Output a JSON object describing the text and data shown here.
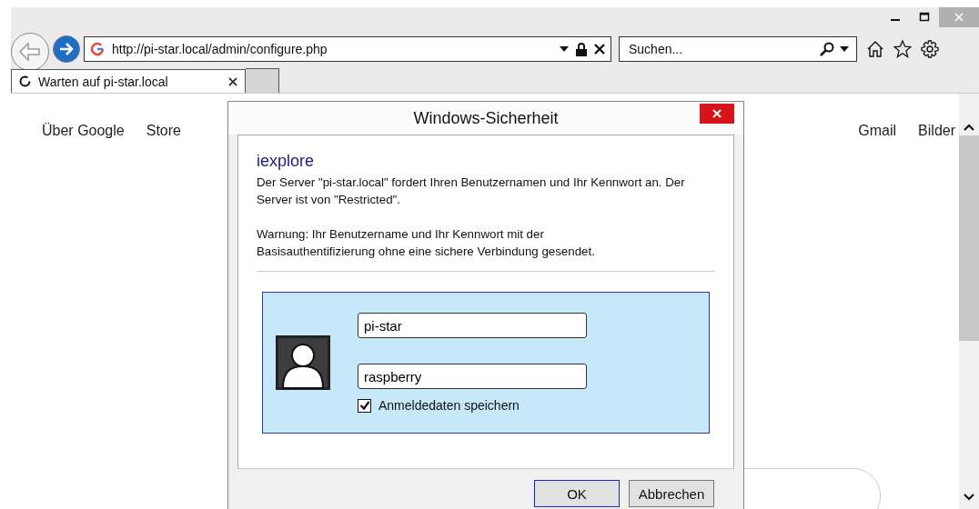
{
  "browser": {
    "url": "http://pi-star.local/admin/configure.php",
    "search": {
      "placeholder": "Suchen..."
    },
    "tabs": [
      {
        "label": "Warten auf pi-star.local",
        "selected": true,
        "loading": true
      }
    ]
  },
  "page": {
    "links_left": [
      "Über Google",
      "Store"
    ],
    "links_right": [
      "Gmail",
      "Bilder"
    ]
  },
  "dialog": {
    "title": "Windows-Sicherheit",
    "app_name": "iexplore",
    "message": "Der Server \"pi-star.local\" fordert Ihren Benutzernamen und Ihr Kennwort an. Der Server ist von \"Restricted\".",
    "warning": "Warnung: Ihr Benutzername und Ihr Kennwort mit der Basisauthentifizierung ohne eine sichere Verbindung gesendet.",
    "username": "pi-star",
    "password": "raspberry",
    "remember": {
      "label": "Anmeldedaten speichern",
      "checked": true
    },
    "buttons": [
      {
        "label": "OK",
        "default": true
      },
      {
        "label": "Abbrechen",
        "default": false
      }
    ]
  }
}
